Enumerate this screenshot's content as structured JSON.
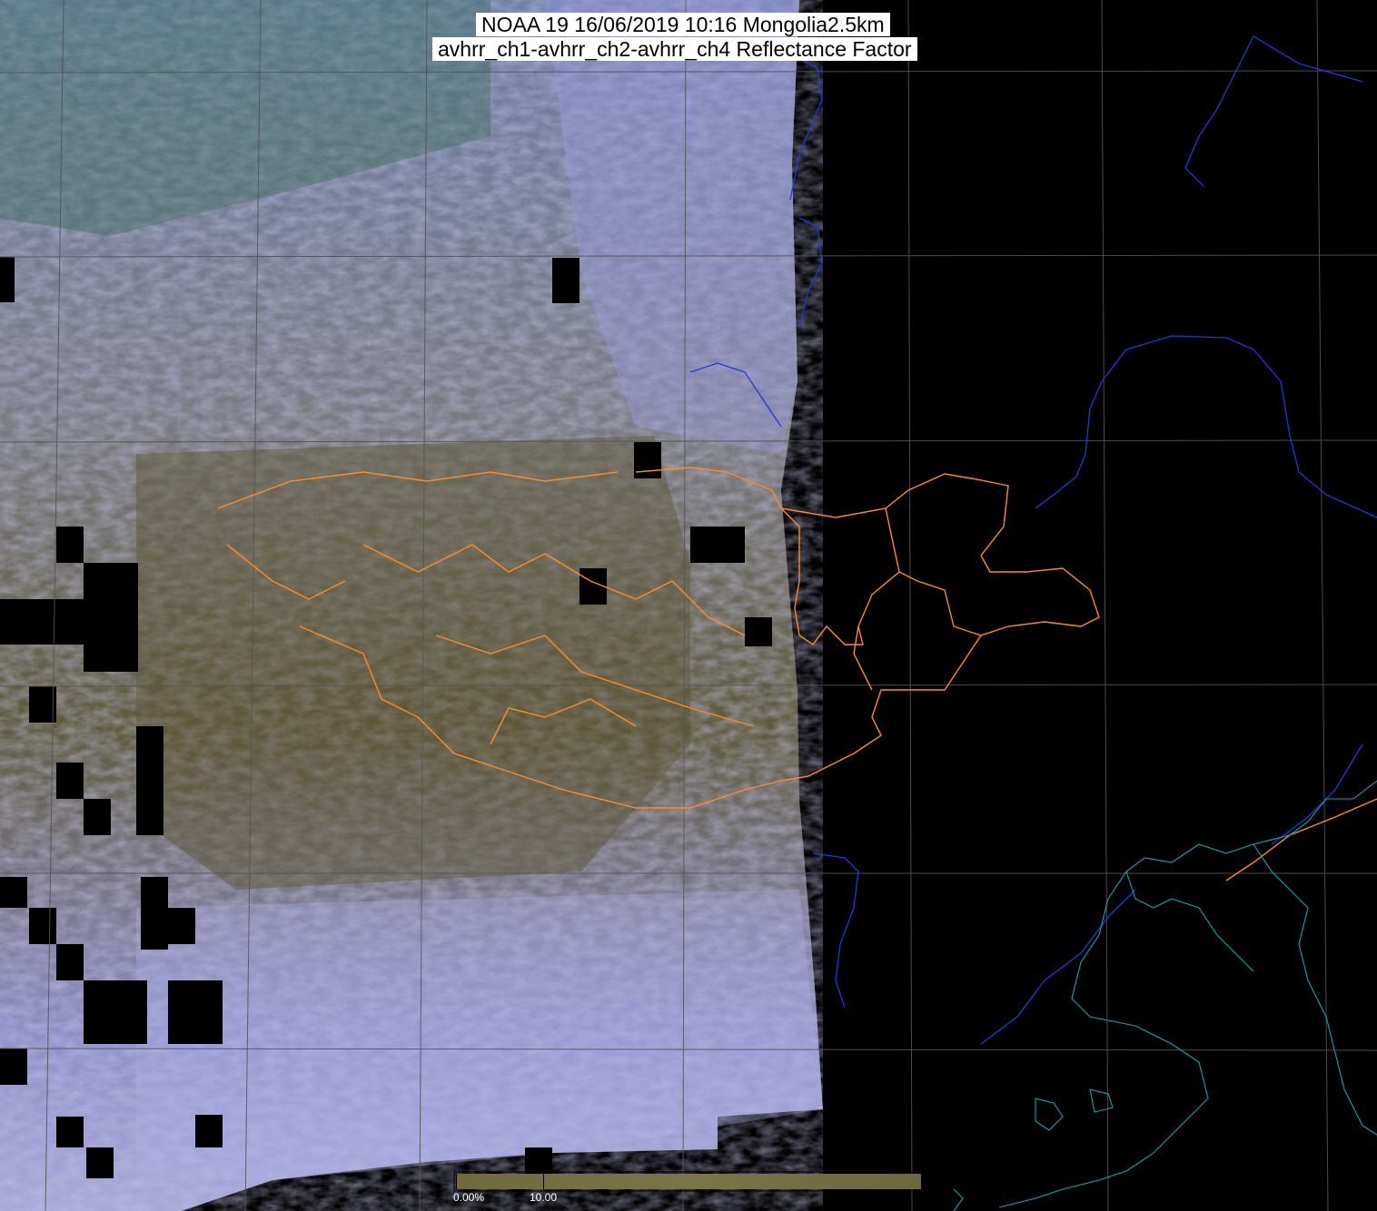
{
  "title": {
    "line1": "NOAA 19 16/06/2019 10:16 Mongolia2.5km",
    "line2": "avhrr_ch1-avhrr_ch2-avhrr_ch4 Reflectance Factor"
  },
  "colorbar": {
    "label_min": "0.00%",
    "label_max": "10.00",
    "value_min": 0.0,
    "value_max": 10.0
  },
  "colors": {
    "background": "#000000",
    "graticule": "#555555",
    "coastline": "#1f3bd6",
    "admin_border": "#ff8a22",
    "china_coast": "#1aa0a8",
    "imagery_blue": "#8f8fd0",
    "imagery_olive": "#6e6a3e",
    "imagery_green": "#2f6a4a"
  }
}
